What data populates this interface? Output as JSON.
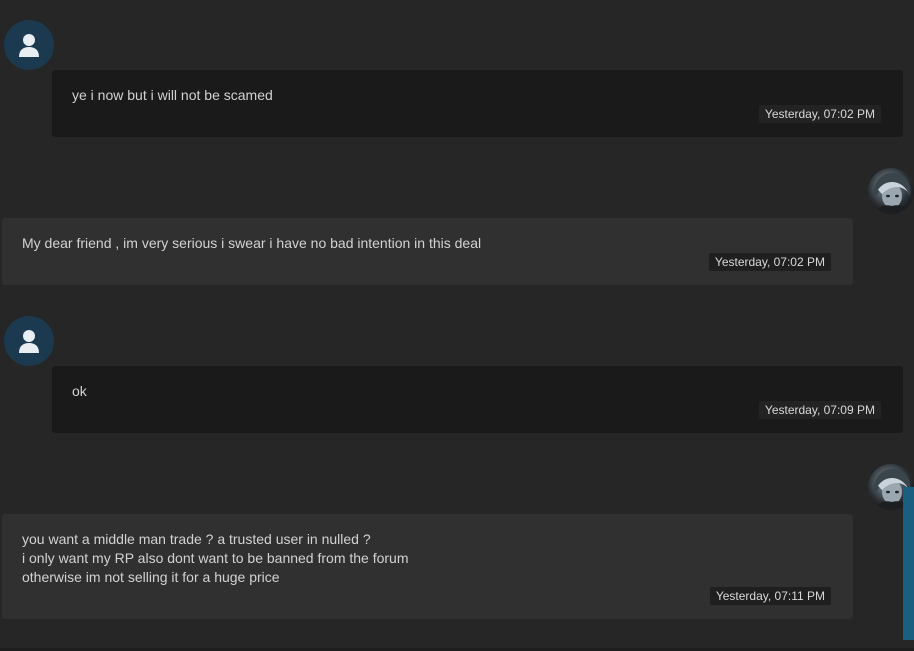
{
  "messages": [
    {
      "direction": "incoming",
      "avatar_icon": "default-user-icon",
      "text": "ye i now but i will not be scamed",
      "timestamp": "Yesterday, 07:02 PM"
    },
    {
      "direction": "outgoing",
      "avatar_icon": "anime-character-avatar",
      "text": "My dear friend , im very serious i swear i have no bad intention in this deal",
      "timestamp": "Yesterday, 07:02 PM"
    },
    {
      "direction": "incoming",
      "avatar_icon": "default-user-icon",
      "text": "ok",
      "timestamp": "Yesterday, 07:09 PM"
    },
    {
      "direction": "outgoing",
      "avatar_icon": "anime-character-avatar",
      "text": "you want a middle man trade ? a trusted user in nulled ?\ni only want my RP also dont want to be banned from the forum\notherwise im not selling it for a huge price",
      "timestamp": "Yesterday, 07:11 PM"
    }
  ],
  "colors": {
    "background": "#262626",
    "incoming_bubble": "#1a1a1a",
    "outgoing_bubble": "#303030",
    "default_avatar": "#1c3a4f",
    "scrollbar": "#1b5f80"
  }
}
